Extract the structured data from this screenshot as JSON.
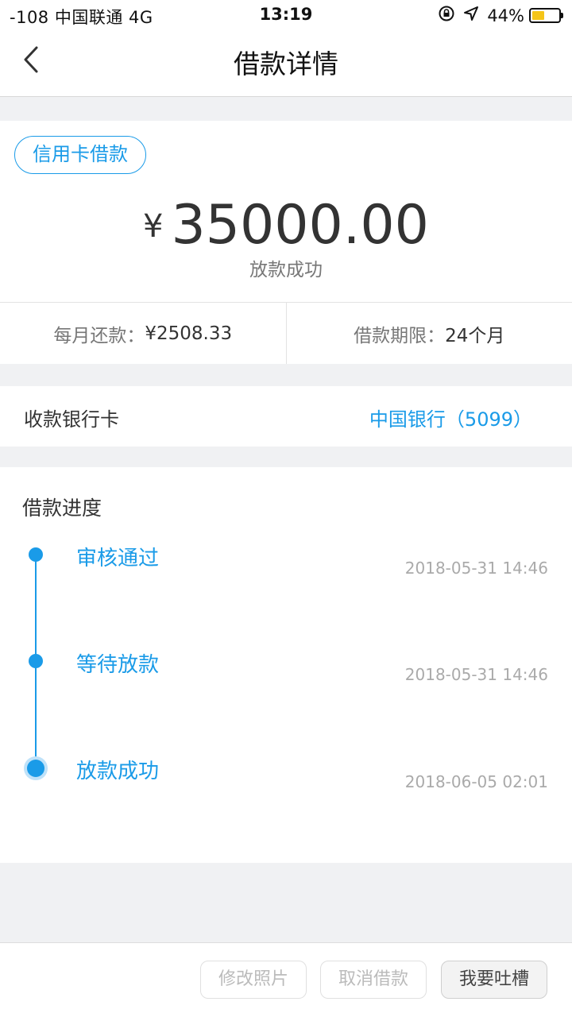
{
  "status_bar": {
    "carrier": "-108 中国联通   4G",
    "time": "13:19",
    "battery": "44%"
  },
  "nav": {
    "title": "借款详情"
  },
  "loan": {
    "tag": "信用卡借款",
    "currency": "¥",
    "amount": "35000.00",
    "status": "放款成功"
  },
  "summary": {
    "monthly_label": "每月还款：",
    "monthly_value": "¥2508.33",
    "term_label": "借款期限：",
    "term_value": "24个月"
  },
  "bank": {
    "label": "收款银行卡",
    "value": "中国银行（5099）"
  },
  "progress": {
    "title": "借款进度",
    "steps": [
      {
        "label": "审核通过",
        "time": "2018-05-31 14:46"
      },
      {
        "label": "等待放款",
        "time": "2018-05-31 14:46"
      },
      {
        "label": "放款成功",
        "time": "2018-06-05 02:01"
      }
    ]
  },
  "actions": {
    "edit_photo": "修改照片",
    "cancel_loan": "取消借款",
    "feedback": "我要吐槽"
  },
  "colors": {
    "accent": "#1a9be8",
    "battery": "#f5c518"
  },
  "icons": [
    "back-icon",
    "rotation-lock-icon",
    "location-arrow-icon",
    "battery-icon"
  ]
}
